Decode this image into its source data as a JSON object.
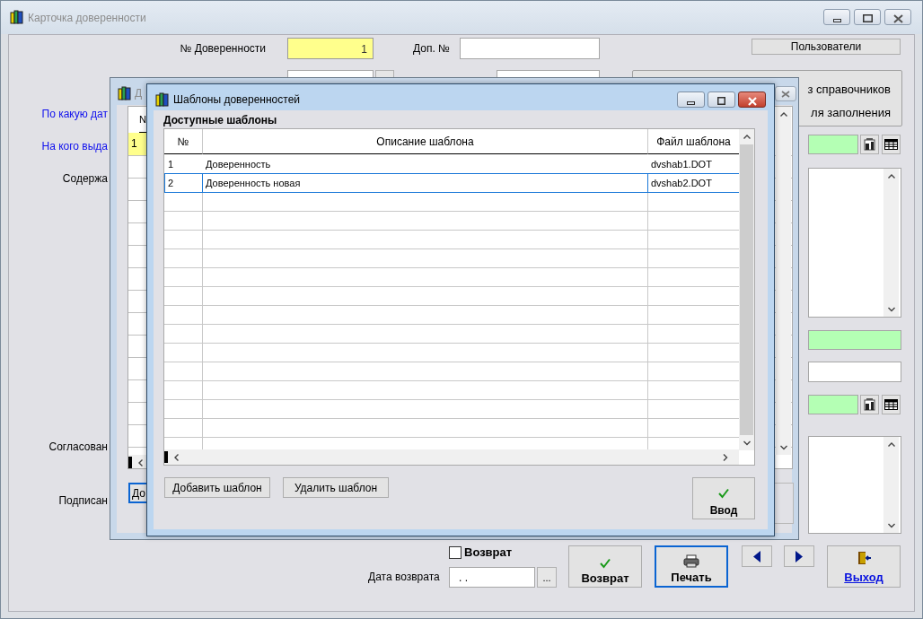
{
  "main": {
    "title": "Карточка доверенности",
    "number_label": "№ Доверенности",
    "number_value": "1",
    "extra_label": "Доп. №",
    "users_button": "Пользователи",
    "fill_button": [
      "з справочников",
      "ля заполнения"
    ],
    "labels": [
      {
        "text": "По какую дат",
        "kind": "link"
      },
      {
        "text": "На кого выда",
        "kind": "link"
      },
      {
        "text": "Содержа",
        "kind": "plain"
      },
      {
        "text": "Согласован",
        "kind": "plain"
      },
      {
        "text": "Подписан",
        "kind": "plain"
      }
    ],
    "side_fields": [
      {
        "kind": "lookup",
        "highlighted": true
      },
      {
        "kind": "memo",
        "highlighted": false
      },
      {
        "kind": "field",
        "highlighted": true
      },
      {
        "kind": "field",
        "highlighted": false
      },
      {
        "kind": "lookup",
        "highlighted": true
      },
      {
        "kind": "memo",
        "highlighted": false
      }
    ],
    "return_checkbox": {
      "label": "Возврат",
      "checked": false
    },
    "return_date": {
      "label": "Дата возврата",
      "value": ". .",
      "button": "..."
    },
    "buttons": [
      {
        "label": "Возврат",
        "kind": "check",
        "focused": false
      },
      {
        "label": "Печать",
        "kind": "print",
        "focused": true
      }
    ],
    "exit_button": "Выход"
  },
  "documents": {
    "title": "Д",
    "column": "N",
    "rows": [
      {
        "cell": "1",
        "selected": true
      }
    ],
    "button": "До"
  },
  "templates": {
    "title": "Шаблоны доверенностей",
    "section": "Доступные шаблоны",
    "columns": [
      "№",
      "Описание шаблона",
      "Файл шаблона"
    ],
    "rows": [
      {
        "cells": [
          "1",
          "Доверенность",
          "dvshab1.DOT"
        ],
        "selected": false
      },
      {
        "cells": [
          "2",
          "Доверенность новая",
          "dvshab2.DOT"
        ],
        "selected": true
      }
    ],
    "buttons": [
      "Добавить шаблон",
      "Удалить шаблон"
    ],
    "ok_button": "Ввод"
  }
}
